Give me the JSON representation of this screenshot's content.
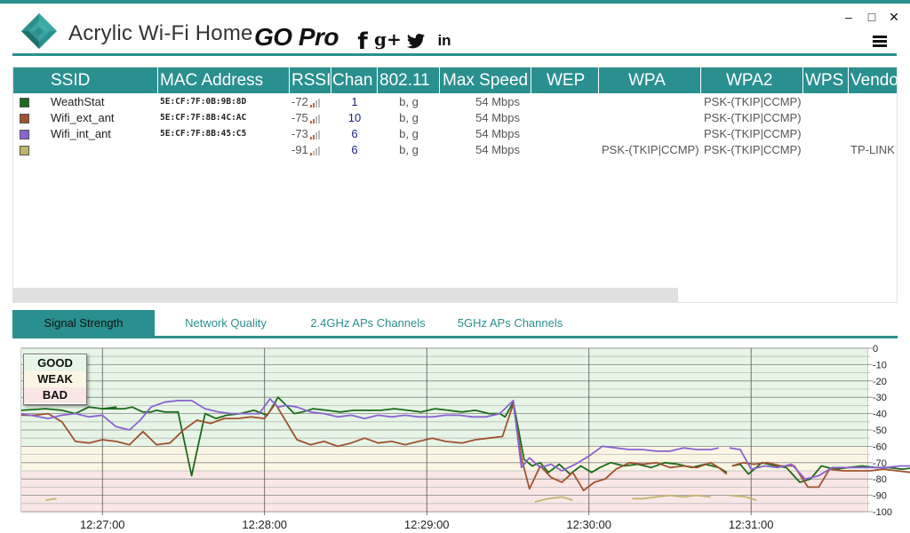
{
  "header": {
    "app_title": "Acrylic Wi-Fi Home",
    "edition": "GO Pro",
    "social": {
      "facebook": "f",
      "google_plus": "g+",
      "linkedin": "in"
    },
    "window_controls": {
      "minimize": "–",
      "maximize": "□",
      "close": "✕"
    }
  },
  "colors": {
    "accent": "#2a8f8f",
    "good": "#e6f5e6",
    "weak": "#fbf6e4",
    "bad": "#fbe6e6"
  },
  "grid": {
    "columns": [
      "SSID",
      "MAC Address",
      "RSSI",
      "Chan",
      "802.11",
      "Max Speed",
      "WEP",
      "WPA",
      "WPA2",
      "WPS",
      "Vendo"
    ],
    "rows": [
      {
        "color": "#1b6b1b",
        "ssid": "WeathStat",
        "mac": "5E:CF:7F:0B:9B:8D",
        "rssi": "-72",
        "signal": 2,
        "chan": "1",
        "std": "b, g",
        "speed": "54 Mbps",
        "wep": "",
        "wpa": "",
        "wpa2": "PSK-(TKIP|CCMP)",
        "wps": "",
        "vendor": ""
      },
      {
        "color": "#a0522d",
        "ssid": "Wifi_ext_ant",
        "mac": "5E:CF:7F:8B:4C:AC",
        "rssi": "-75",
        "signal": 2,
        "chan": "10",
        "std": "b, g",
        "speed": "54 Mbps",
        "wep": "",
        "wpa": "",
        "wpa2": "PSK-(TKIP|CCMP)",
        "wps": "",
        "vendor": ""
      },
      {
        "color": "#8a63d2",
        "ssid": "Wifi_int_ant",
        "mac": "5E:CF:7F:8B:45:C5",
        "rssi": "-73",
        "signal": 2,
        "chan": "6",
        "std": "b, g",
        "speed": "54 Mbps",
        "wep": "",
        "wpa": "",
        "wpa2": "PSK-(TKIP|CCMP)",
        "wps": "",
        "vendor": ""
      },
      {
        "color": "#bdb76b",
        "ssid": "",
        "mac": "",
        "rssi": "-91",
        "signal": 1,
        "chan": "6",
        "std": "b, g",
        "speed": "54 Mbps",
        "wep": "",
        "wpa": "PSK-(TKIP|CCMP)",
        "wpa2": "PSK-(TKIP|CCMP)",
        "wps": "",
        "vendor": "TP-LINK"
      }
    ]
  },
  "tabs": [
    {
      "label": "Signal Strength",
      "active": true
    },
    {
      "label": "Network Quality",
      "active": false
    },
    {
      "label": "2.4GHz APs Channels",
      "active": false
    },
    {
      "label": "5GHz APs Channels",
      "active": false
    }
  ],
  "legend": {
    "good": "GOOD",
    "weak": "WEAK",
    "bad": "BAD"
  },
  "chart_data": {
    "type": "line",
    "ylim": [
      -100,
      0
    ],
    "y_ticks": [
      "0",
      "-10",
      "-20",
      "-30",
      "-40",
      "-50",
      "-60",
      "-70",
      "-80",
      "-90",
      "-100"
    ],
    "x_ticks": [
      "12:27:00",
      "12:28:00",
      "12:29:00",
      "12:30:00",
      "12:31:00"
    ],
    "x_range_seconds": [
      -30,
      283
    ],
    "x_tick_seconds": [
      0,
      60,
      120,
      180,
      240
    ],
    "zones": [
      {
        "label": "GOOD",
        "from": 0,
        "to": -60,
        "color": "#e6f5e6"
      },
      {
        "label": "WEAK",
        "from": -60,
        "to": -75,
        "color": "#fbf6e4"
      },
      {
        "label": "BAD",
        "from": -75,
        "to": -100,
        "color": "#fbe6e6"
      }
    ],
    "series": [
      {
        "name": "WeathStat",
        "color": "#1b6b1b",
        "segments": [
          [
            [
              -30,
              -38
            ],
            [
              -21,
              -37
            ],
            [
              -15,
              -38
            ],
            [
              -10,
              -40
            ],
            [
              -5,
              -36
            ],
            [
              0,
              -37
            ],
            [
              5,
              -36
            ],
            [
              0,
              -37
            ],
            [
              8,
              -37
            ],
            [
              11,
              -36
            ],
            [
              15,
              -39
            ],
            [
              18,
              -39
            ],
            [
              20,
              -38
            ],
            [
              23,
              -39
            ],
            [
              28,
              -39
            ],
            [
              33,
              -78
            ],
            [
              38,
              -40
            ],
            [
              42,
              -43
            ],
            [
              46,
              -41
            ],
            [
              51,
              -40
            ],
            [
              56,
              -38
            ],
            [
              61,
              -41
            ],
            [
              65,
              -30
            ],
            [
              68,
              -35
            ],
            [
              71,
              -40
            ],
            [
              74,
              -39
            ],
            [
              78,
              -37
            ],
            [
              83,
              -38
            ],
            [
              88,
              -39
            ],
            [
              93,
              -38
            ],
            [
              98,
              -38
            ],
            [
              103,
              -38
            ],
            [
              108,
              -37
            ],
            [
              113,
              -38
            ],
            [
              118,
              -39
            ],
            [
              123,
              -37
            ],
            [
              128,
              -38
            ],
            [
              133,
              -39
            ],
            [
              138,
              -38
            ],
            [
              143,
              -40
            ],
            [
              147,
              -40
            ],
            [
              149,
              -42
            ],
            [
              152,
              -33
            ],
            [
              156,
              -68
            ],
            [
              159,
              -72
            ],
            [
              162,
              -70
            ],
            [
              165,
              -76
            ],
            [
              169,
              -71
            ],
            [
              173,
              -77
            ],
            [
              177,
              -72
            ],
            [
              181,
              -76
            ],
            [
              184,
              -73
            ],
            [
              188,
              -70
            ],
            [
              193,
              -72
            ],
            [
              198,
              -71
            ],
            [
              203,
              -73
            ],
            [
              208,
              -70
            ],
            [
              213,
              -71
            ],
            [
              218,
              -73
            ],
            [
              223,
              -71
            ],
            [
              228,
              -73
            ],
            [
              231,
              -76
            ]
          ],
          [
            [
              233,
              -72
            ],
            [
              236,
              -71
            ],
            [
              239,
              -77
            ],
            [
              244,
              -70
            ],
            [
              249,
              -72
            ],
            [
              253,
              -73
            ],
            [
              258,
              -82
            ],
            [
              262,
              -80
            ],
            [
              266,
              -72
            ],
            [
              271,
              -74
            ],
            [
              276,
              -73
            ],
            [
              281,
              -72
            ],
            [
              286,
              -73
            ],
            [
              291,
              -73
            ],
            [
              296,
              -74
            ],
            [
              301,
              -73
            ],
            [
              305,
              -74
            ]
          ]
        ]
      },
      {
        "name": "Wifi_ext_ant",
        "color": "#a0522d",
        "segments": [
          [
            [
              -30,
              -41
            ],
            [
              -25,
              -41
            ],
            [
              -20,
              -40
            ],
            [
              -15,
              -45
            ],
            [
              -10,
              -57
            ],
            [
              -5,
              -58
            ],
            [
              0,
              -56
            ],
            [
              5,
              -57
            ],
            [
              10,
              -59
            ],
            [
              15,
              -51
            ],
            [
              20,
              -59
            ],
            [
              25,
              -58
            ],
            [
              30,
              -50
            ],
            [
              35,
              -44
            ],
            [
              40,
              -46
            ],
            [
              45,
              -43
            ],
            [
              50,
              -43
            ],
            [
              55,
              -42
            ],
            [
              60,
              -43
            ],
            [
              64,
              -34
            ],
            [
              68,
              -45
            ],
            [
              72,
              -56
            ],
            [
              77,
              -59
            ],
            [
              82,
              -57
            ],
            [
              87,
              -60
            ],
            [
              92,
              -58
            ],
            [
              97,
              -55
            ],
            [
              102,
              -58
            ],
            [
              107,
              -57
            ],
            [
              112,
              -59
            ],
            [
              117,
              -57
            ],
            [
              122,
              -55
            ],
            [
              127,
              -57
            ],
            [
              133,
              -58
            ],
            [
              138,
              -56
            ],
            [
              143,
              -55
            ],
            [
              148,
              -54
            ],
            [
              152,
              -34
            ],
            [
              155,
              -67
            ],
            [
              158,
              -86
            ],
            [
              162,
              -72
            ],
            [
              166,
              -79
            ],
            [
              170,
              -82
            ],
            [
              174,
              -76
            ],
            [
              178,
              -87
            ],
            [
              182,
              -82
            ],
            [
              186,
              -80
            ],
            [
              190,
              -74
            ],
            [
              195,
              -70
            ],
            [
              200,
              -71
            ],
            [
              205,
              -70
            ],
            [
              210,
              -73
            ],
            [
              215,
              -72
            ],
            [
              220,
              -73
            ],
            [
              225,
              -70
            ],
            [
              228,
              -73
            ],
            [
              231,
              -77
            ]
          ],
          [
            [
              233,
              -72
            ],
            [
              237,
              -70
            ],
            [
              241,
              -71
            ],
            [
              246,
              -70
            ],
            [
              251,
              -72
            ],
            [
              256,
              -72
            ],
            [
              261,
              -85
            ],
            [
              265,
              -85
            ],
            [
              269,
              -74
            ],
            [
              274,
              -75
            ],
            [
              279,
              -75
            ],
            [
              284,
              -75
            ],
            [
              289,
              -74
            ],
            [
              294,
              -75
            ],
            [
              299,
              -76
            ],
            [
              304,
              -74
            ]
          ]
        ]
      },
      {
        "name": "Wifi_int_ant",
        "color": "#8a63d2",
        "segments": [
          [
            [
              -30,
              -40
            ],
            [
              -20,
              -43
            ],
            [
              -15,
              -41
            ],
            [
              -10,
              -40
            ],
            [
              -5,
              -42
            ],
            [
              0,
              -41
            ],
            [
              5,
              -48
            ],
            [
              10,
              -50
            ],
            [
              14,
              -44
            ],
            [
              18,
              -36
            ],
            [
              23,
              -33
            ],
            [
              28,
              -32
            ],
            [
              33,
              -32
            ],
            [
              38,
              -37
            ],
            [
              43,
              -39
            ],
            [
              48,
              -40
            ],
            [
              53,
              -40
            ],
            [
              58,
              -40
            ],
            [
              62,
              -31
            ],
            [
              65,
              -36
            ],
            [
              68,
              -35
            ],
            [
              72,
              -36
            ],
            [
              77,
              -39
            ],
            [
              82,
              -40
            ],
            [
              87,
              -42
            ],
            [
              92,
              -41
            ],
            [
              97,
              -43
            ],
            [
              102,
              -41
            ],
            [
              107,
              -42
            ],
            [
              112,
              -41
            ],
            [
              117,
              -42
            ],
            [
              122,
              -42
            ],
            [
              127,
              -41
            ],
            [
              132,
              -41
            ],
            [
              137,
              -42
            ],
            [
              142,
              -42
            ],
            [
              147,
              -40
            ],
            [
              152,
              -32
            ],
            [
              155,
              -73
            ],
            [
              158,
              -67
            ],
            [
              162,
              -73
            ],
            [
              166,
              -71
            ],
            [
              170,
              -75
            ],
            [
              175,
              -71
            ],
            [
              180,
              -66
            ],
            [
              185,
              -60
            ],
            [
              190,
              -61
            ],
            [
              195,
              -62
            ],
            [
              200,
              -62
            ],
            [
              205,
              -63
            ],
            [
              210,
              -63
            ],
            [
              215,
              -61
            ],
            [
              220,
              -62
            ],
            [
              225,
              -62
            ],
            [
              228,
              -61
            ]
          ],
          [
            [
              232,
              -61
            ],
            [
              236,
              -62
            ],
            [
              240,
              -74
            ],
            [
              245,
              -72
            ],
            [
              250,
              -73
            ],
            [
              255,
              -71
            ],
            [
              260,
              -80
            ],
            [
              265,
              -78
            ],
            [
              270,
              -73
            ],
            [
              275,
              -73
            ],
            [
              280,
              -73
            ],
            [
              285,
              -73
            ],
            [
              290,
              -73
            ],
            [
              295,
              -72
            ],
            [
              300,
              -72
            ],
            [
              305,
              -73
            ]
          ]
        ]
      },
      {
        "name": "",
        "color": "#bdb76b",
        "segments": [
          [
            [
              -21,
              -93
            ],
            [
              -17,
              -92
            ]
          ],
          [
            [
              160,
              -94
            ],
            [
              165,
              -92
            ],
            [
              170,
              -91
            ],
            [
              174,
              -93
            ]
          ],
          [
            [
              196,
              -92
            ],
            [
              200,
              -92
            ],
            [
              205,
              -91
            ],
            [
              210,
              -90
            ],
            [
              215,
              -91
            ],
            [
              220,
              -90
            ],
            [
              225,
              -91
            ]
          ],
          [
            [
              232,
              -90
            ],
            [
              238,
              -91
            ],
            [
              242,
              -93
            ]
          ]
        ]
      }
    ]
  }
}
